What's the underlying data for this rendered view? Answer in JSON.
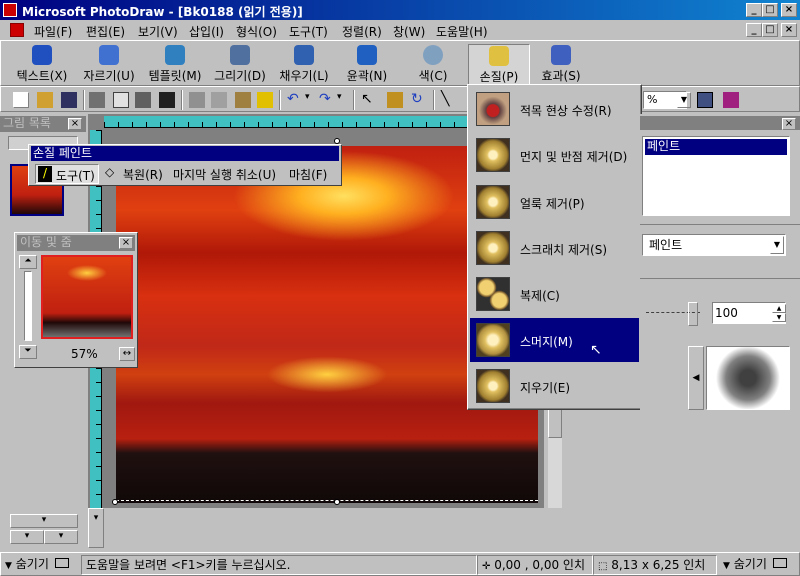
{
  "window": {
    "title": "Microsoft PhotoDraw - [Bk0188 (읽기 전용)]"
  },
  "menu": [
    {
      "label": "파일(F)"
    },
    {
      "label": "편집(E)"
    },
    {
      "label": "보기(V)"
    },
    {
      "label": "삽입(I)"
    },
    {
      "label": "형식(O)"
    },
    {
      "label": "도구(T)"
    },
    {
      "label": "정렬(R)"
    },
    {
      "label": "창(W)"
    },
    {
      "label": "도움말(H)"
    }
  ],
  "big_toolbar": [
    {
      "label": "텍스트(X)",
      "icon": "text-icon",
      "color": "#2050c0"
    },
    {
      "label": "자르기(U)",
      "icon": "scissors-icon",
      "color": "#4070d0"
    },
    {
      "label": "템플릿(M)",
      "icon": "template-icon",
      "color": "#3080c0"
    },
    {
      "label": "그리기(D)",
      "icon": "draw-icon",
      "color": "#5070a0"
    },
    {
      "label": "채우기(L)",
      "icon": "fill-icon",
      "color": "#3060b0"
    },
    {
      "label": "윤곽(N)",
      "icon": "outline-icon",
      "color": "#2060c0"
    },
    {
      "label": "색(C)",
      "icon": "color-icon",
      "color": "#80a0c0"
    },
    {
      "label": "손질(P)",
      "icon": "touchup-icon",
      "color": "#e0c040"
    },
    {
      "label": "효과(S)",
      "icon": "effects-icon",
      "color": "#4060c0"
    }
  ],
  "std_toolbar": {
    "zoom": "%"
  },
  "gallery_panel": {
    "title": "그림 목록"
  },
  "touchup_toolbar": {
    "title": "손질 페인트",
    "tool_label": "도구(T)",
    "restore_label": "복원(R)",
    "undo_label": "마지막 실행 취소(U)",
    "finish_label": "마침(F)"
  },
  "pan_zoom": {
    "title": "이동 및 줌",
    "zoom": "57%"
  },
  "touchup_menu": [
    {
      "label": "적목 현상 수정(R)",
      "icon": "red-eye-icon"
    },
    {
      "label": "먼지 및 반점 제거(D)",
      "icon": "dust-icon"
    },
    {
      "label": "얼룩 제거(P)",
      "icon": "blemish-icon"
    },
    {
      "label": "스크래치 제거(S)",
      "icon": "scratch-icon"
    },
    {
      "label": "복제(C)",
      "icon": "clone-icon"
    },
    {
      "label": "스머지(M)",
      "icon": "smudge-icon"
    },
    {
      "label": "지우기(E)",
      "icon": "erase-icon"
    }
  ],
  "right_panel": {
    "list_item": "페인트",
    "dropdown": "페인트",
    "value": "100"
  },
  "status": {
    "left_hide": "숨기기",
    "hint": "도움말을 보려면 <F1>키를 누르십시오.",
    "coords": "0,00 , 0,00 인치",
    "size": "8,13 x 6,25 인치",
    "right_hide": "숨기기"
  },
  "colors": {
    "titlebar": "#000080",
    "selection": "#000080",
    "ruler": "#40c0c0"
  }
}
